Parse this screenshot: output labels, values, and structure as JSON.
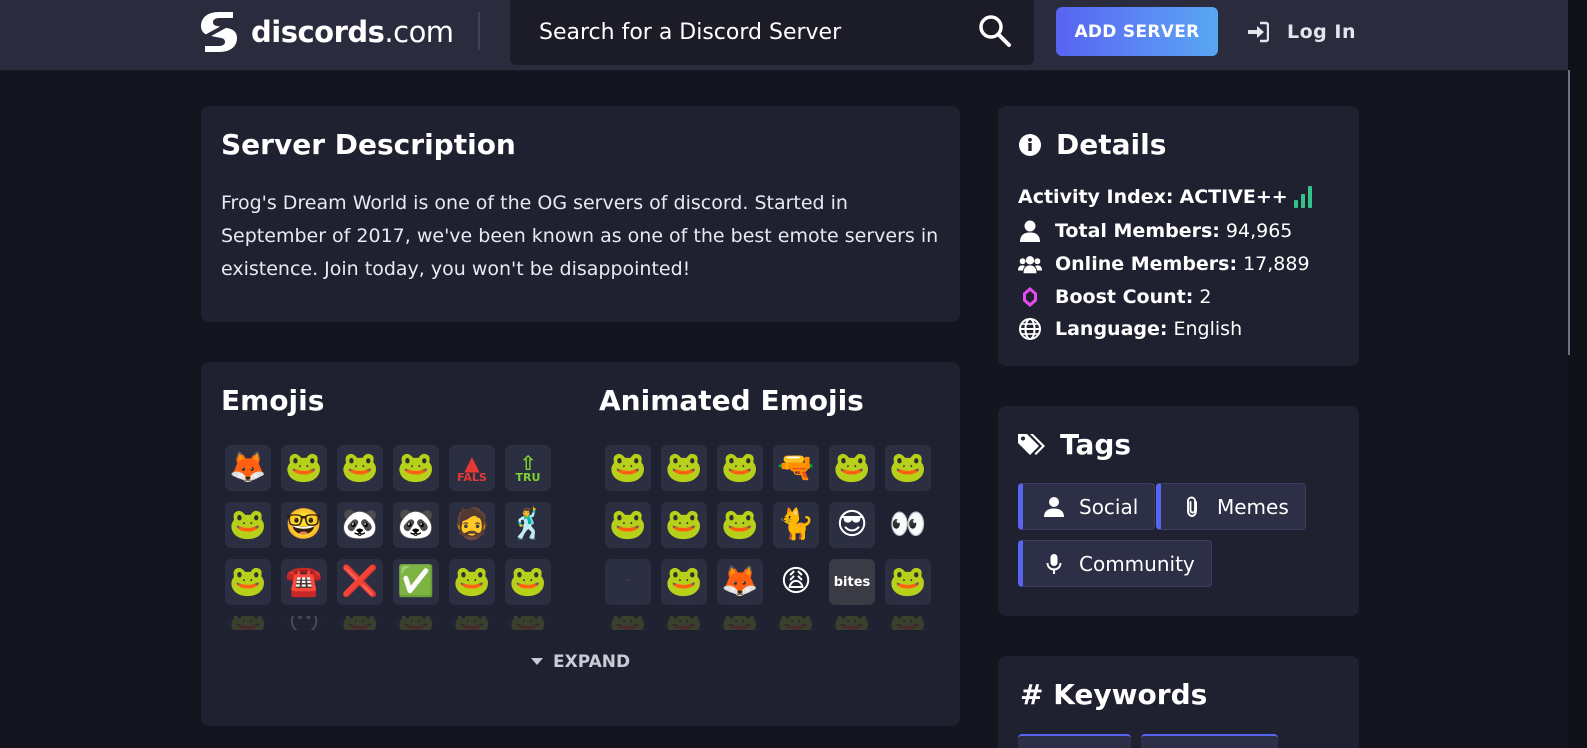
{
  "header": {
    "logo_brand": "discords",
    "logo_domain": ".com",
    "search_placeholder": "Search for a Discord Server",
    "add_server_label": "ADD SERVER",
    "login_label": "Log In"
  },
  "description": {
    "title": "Server Description",
    "text": "Frog's Dream World is one of the OG servers of discord. Started in September of 2017, we've been known as one of the best emote servers in existence. Join today, you won't be disappointed!"
  },
  "emojis": {
    "title": "Emojis",
    "items": [
      "🦊",
      "🐸",
      "🐸",
      "🐸",
      "FALS",
      "TRU",
      "🐸",
      "🤓",
      "🐼",
      "🐼",
      "🧔",
      "🕺",
      "🐸",
      "☎️",
      "❌",
      "✅",
      "🐸",
      "🐸"
    ],
    "fade": [
      "🐸",
      "😶",
      "🐸",
      "🐸",
      "🐸",
      "🐸"
    ]
  },
  "animated_emojis": {
    "title": "Animated Emojis",
    "items": [
      "🐸",
      "🐸",
      "🐸",
      "🔫",
      "🐸",
      "🐸",
      "🐸",
      "🐸",
      "🐸",
      "🐈",
      "😎",
      "👀",
      "·",
      "🐸",
      "🦊",
      "😩",
      "bites",
      "🐸"
    ],
    "fade": [
      "🐸",
      "🐸",
      "🐸",
      "🐸",
      "🐸",
      "🐸"
    ]
  },
  "expand_label": "EXPAND",
  "details": {
    "title": "Details",
    "activity_label": "Activity Index:",
    "activity_value": "ACTIVE++",
    "total_members_label": "Total Members:",
    "total_members_value": "94,965",
    "online_members_label": "Online Members:",
    "online_members_value": "17,889",
    "boost_label": "Boost Count:",
    "boost_value": "2",
    "language_label": "Language:",
    "language_value": "English"
  },
  "tags": {
    "title": "Tags",
    "items": [
      {
        "label": "Social",
        "icon": "user-icon"
      },
      {
        "label": "Memes",
        "icon": "paperclip-icon"
      },
      {
        "label": "Community",
        "icon": "microphone-icon"
      }
    ]
  },
  "keywords": {
    "title": "# Keywords"
  },
  "colors": {
    "accent": "#5865f2",
    "activity_green": "#33c28a",
    "boost_pink": "#e44cf0",
    "card_bg": "#1f2030",
    "page_bg": "#14151f"
  }
}
